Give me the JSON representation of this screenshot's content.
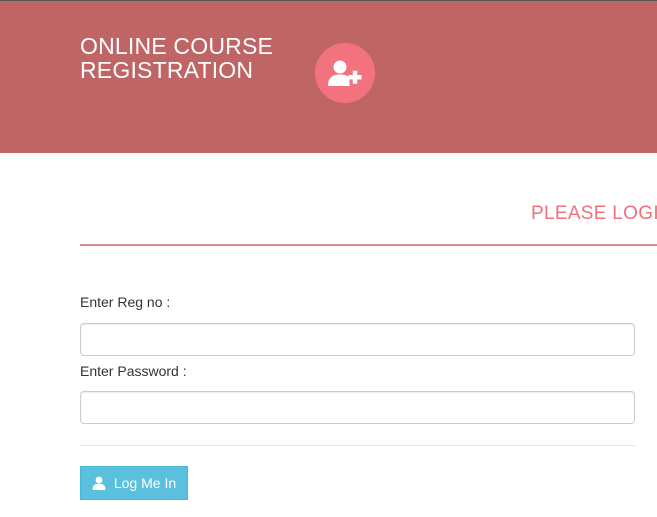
{
  "header": {
    "title_line1": "ONLINE COURSE",
    "title_line2": "REGISTRATION",
    "icon": "user-plus-icon"
  },
  "login": {
    "heading": "PLEASE LOGIN",
    "reg_label": "Enter Reg no :",
    "reg_value": "",
    "password_label": "Enter Password :",
    "password_value": "",
    "button_label": "Log Me In",
    "button_icon": "user-icon"
  },
  "colors": {
    "header_bg": "#c06565",
    "accent_pink": "#f3727f",
    "heading_pink": "#f1707e",
    "button_bg": "#5bc0de"
  }
}
